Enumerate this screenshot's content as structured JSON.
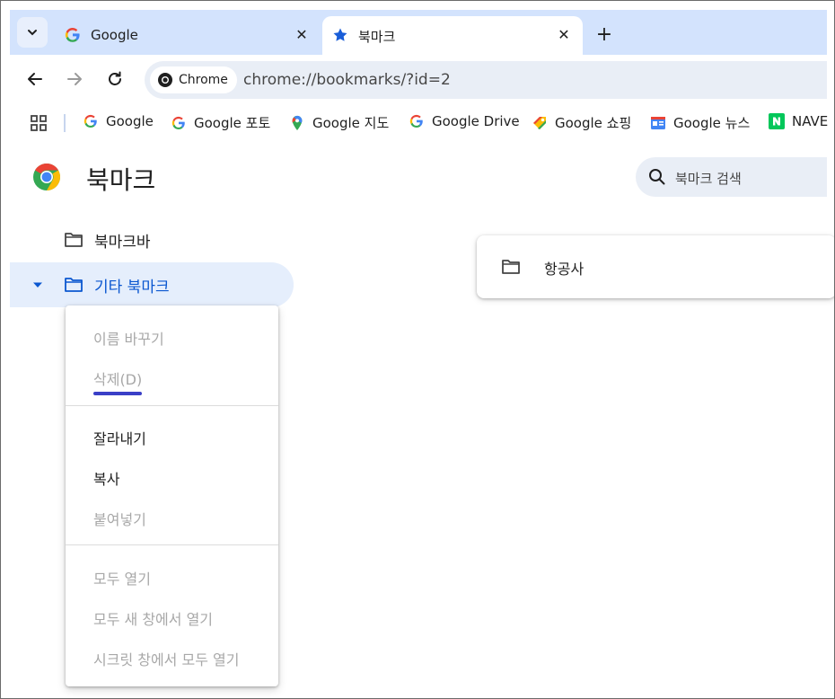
{
  "tabs": [
    {
      "title": "Google",
      "icon": "google-g-icon",
      "active": false
    },
    {
      "title": "북마크",
      "icon": "star-icon",
      "active": true
    }
  ],
  "toolbar": {
    "chip_label": "Chrome",
    "url": "chrome://bookmarks/?id=2"
  },
  "bookmarks_bar": [
    {
      "label": "Google",
      "icon": "google-g-icon"
    },
    {
      "label": "Google 포토",
      "icon": "google-g-icon"
    },
    {
      "label": "Google 지도",
      "icon": "maps-pin-icon"
    },
    {
      "label": "Google Drive",
      "icon": "google-g-icon"
    },
    {
      "label": "Google 쇼핑",
      "icon": "shopping-tag-icon"
    },
    {
      "label": "Google 뉴스",
      "icon": "news-icon"
    },
    {
      "label": "NAVE",
      "icon": "naver-icon"
    }
  ],
  "page": {
    "title": "북마크",
    "search_placeholder": "북마크 검색"
  },
  "tree": {
    "bookmarks_bar": "북마크바",
    "other_bookmarks": "기타 북마크"
  },
  "list": [
    {
      "label": "항공사",
      "icon": "folder-icon"
    }
  ],
  "context_menu": {
    "rename": "이름 바꾸기",
    "delete": "삭제(D)",
    "cut": "잘라내기",
    "copy": "복사",
    "paste": "붙여넣기",
    "open_all": "모두 열기",
    "open_all_new_window": "모두 새 창에서 열기",
    "open_all_incognito": "시크릿 창에서 모두 열기"
  },
  "colors": {
    "tabstrip": "#d3e3fd",
    "accent": "#0b57d0",
    "selected_row": "#e5eefc",
    "disabled_text": "#a8a8a8",
    "underline": "#3a3fc7"
  }
}
